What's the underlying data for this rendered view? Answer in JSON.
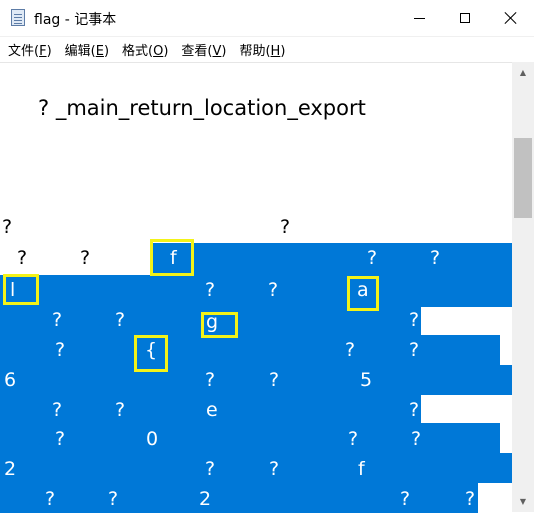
{
  "window": {
    "title": "flag - 记事本",
    "buttons": {
      "minimize": "minimize-icon",
      "maximize": "maximize-icon",
      "close": "close-icon"
    }
  },
  "menu": [
    {
      "label": "文件(",
      "key": "F",
      "end": ")"
    },
    {
      "label": "编辑(",
      "key": "E",
      "end": ")"
    },
    {
      "label": "格式(",
      "key": "O",
      "end": ")"
    },
    {
      "label": "查看(",
      "key": "V",
      "end": ")"
    },
    {
      "label": "帮助(",
      "key": "H",
      "end": ")"
    }
  ],
  "editor": {
    "heading": "? _main_return_location_export",
    "glyphs": [
      "?",
      "?",
      "?",
      "?",
      "f",
      "?",
      "?",
      "l",
      "?",
      "?",
      "a",
      "?",
      "?",
      "g",
      "?",
      "?",
      "{",
      "?",
      "?",
      "6",
      "?",
      "?",
      "5",
      "?",
      "?",
      "e",
      "?",
      "?",
      "0",
      "?",
      "?",
      "2",
      "?",
      "?",
      "f",
      "?",
      "?",
      "2",
      "?",
      "?"
    ]
  },
  "colors": {
    "selection": "#0078d7",
    "highlight_box": "#f3f318",
    "scrollbar_track": "#f0f0f0",
    "scrollbar_thumb": "#c1c1c1"
  }
}
